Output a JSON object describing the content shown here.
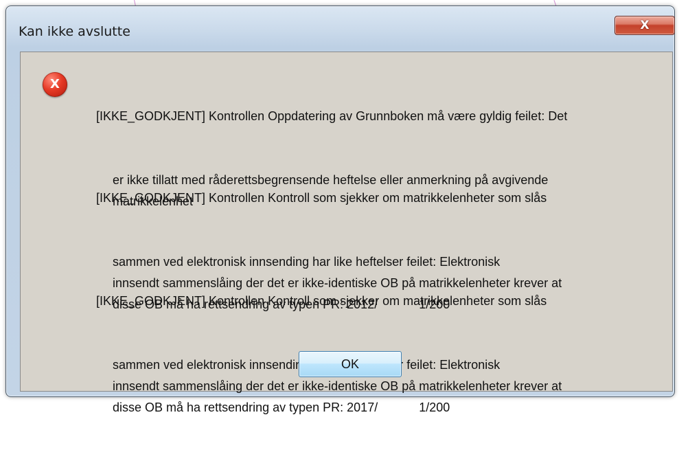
{
  "dialog": {
    "title": "Kan ikke avslutte",
    "close_label": "X",
    "icon": "error-icon",
    "icon_glyph": "X",
    "messages": [
      {
        "first": "[IKKE_GODKJENT] Kontrollen Oppdatering av Grunnboken må være gyldig feilet: Det",
        "rest": "er ikke tillatt med råderettsbegrensende heftelse eller anmerkning på avgivende\nmatrikkelenhet"
      },
      {
        "first": "[IKKE_GODKJENT] Kontrollen Kontroll som sjekker om matrikkelenheter som slås",
        "rest": "sammen ved elektronisk innsending har like heftelser feilet: Elektronisk\ninnsendt sammenslåing der det er ikke-identiske OB på matrikkelenheter krever at\ndisse OB må ha rettsendring av typen PR: 2012/            1/200"
      },
      {
        "first": "[IKKE_GODKJENT] Kontrollen Kontroll som sjekker om matrikkelenheter som slås",
        "rest": "sammen ved elektronisk innsending har like heftelser feilet: Elektronisk\ninnsendt sammenslåing der det er ikke-identiske OB på matrikkelenheter krever at\ndisse OB må ha rettsendring av typen PR: 2017/            1/200"
      }
    ],
    "ok_label": "OK"
  }
}
